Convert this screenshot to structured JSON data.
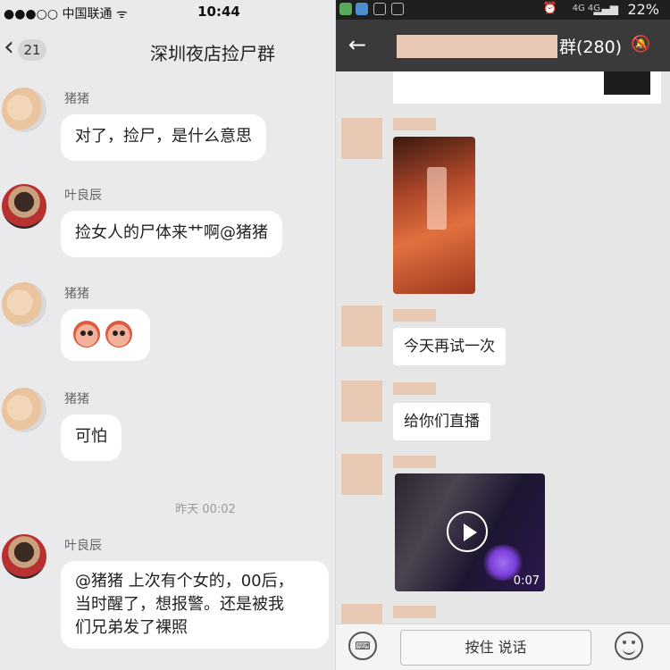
{
  "left": {
    "status": {
      "signal": "●●●○○",
      "carrier": "中国联通",
      "wifi": "ᯤ",
      "time": "10:44"
    },
    "nav": {
      "back": "‹",
      "badge": "21",
      "title": "深圳夜店捡尸群"
    },
    "messages": [
      {
        "sender": "猪猪",
        "text": "对了，捡尸，是什么意思"
      },
      {
        "sender": "叶良辰",
        "text": "捡女人的尸体来艹啊@猪猪"
      },
      {
        "sender": "猪猪",
        "text": ""
      },
      {
        "sender": "猪猪",
        "text": "可怕"
      }
    ],
    "time_separator": "昨天 00:02",
    "last_message": {
      "sender": "叶良辰",
      "lines": [
        "@猪猪 上次有个女的，00后，",
        "当时醒了，想报警。还是被我",
        "们兄弟发了裸照"
      ]
    }
  },
  "right": {
    "status": {
      "battery": "22%",
      "net": "4G 4G"
    },
    "header": {
      "title": "群(280)",
      "back": "←",
      "mute": "🔕"
    },
    "messages": [
      {
        "text": "今天再试一次"
      },
      {
        "text": "给你们直播"
      }
    ],
    "video_duration": "0:07",
    "input": {
      "hold_to_talk": "按住 说话"
    }
  }
}
